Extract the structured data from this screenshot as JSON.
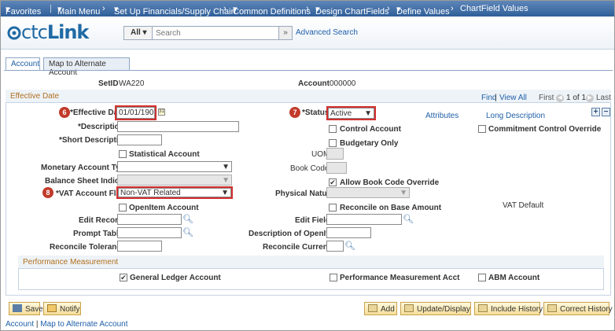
{
  "navbar": {
    "favorites": "Favorites",
    "main_menu": "Main Menu",
    "crumbs": [
      "Set Up Financials/Supply Chain",
      "Common Definitions",
      "Design ChartFields",
      "Define Values"
    ],
    "current": "ChartField Values"
  },
  "header": {
    "logo_prefix": "ctc",
    "logo_suffix": "Link",
    "search_scope": "All",
    "search_placeholder": "Search",
    "advanced_search": "Advanced Search"
  },
  "tabs": [
    {
      "label": "Account"
    },
    {
      "label": "Map to Alternate Account"
    }
  ],
  "keys": {
    "setid_label": "SetID",
    "setid_value": "WA220",
    "account_label": "Account",
    "account_value": "000000"
  },
  "effective_date_section": {
    "title": "Effective Date",
    "find": "Find",
    "view_all": "View All",
    "first": "First",
    "pager": "1 of 1",
    "last": "Last",
    "attributes": "Attributes",
    "long_description": "Long Description"
  },
  "fields": {
    "effective_date_label": "*Effective Date",
    "effective_date_value": "01/01/1901",
    "status_label": "*Status",
    "status_value": "Active",
    "description_label": "*Description",
    "short_description_label": "*Short Description",
    "control_account": "Control Account",
    "commitment_control_override": "Commitment Control Override",
    "budgetary_only": "Budgetary Only",
    "statistical_account": "Statistical Account",
    "uom_label": "UOM",
    "monetary_account_type_label": "Monetary Account Type",
    "book_code_label": "Book Code",
    "balance_sheet_indicator_label": "Balance Sheet Indicator",
    "allow_book_code_override": "Allow Book Code Override",
    "vat_account_flag_label": "*VAT Account Flag",
    "vat_account_flag_value": "Non-VAT Related",
    "physical_nature_label": "Physical Nature",
    "openitem_account": "OpenItem Account",
    "reconcile_on_base_amount": "Reconcile on Base Amount",
    "vat_default": "VAT Default",
    "edit_record_label": "Edit Record",
    "edit_field_label": "Edit Field",
    "prompt_table_label": "Prompt Table",
    "description_of_openitem_label": "Description of OpenItem",
    "reconcile_tolerance_label": "Reconcile Tolerance",
    "reconcile_currency_label": "Reconcile Currency"
  },
  "callouts": {
    "effective_date": "6",
    "status": "7",
    "vat_flag": "8"
  },
  "performance": {
    "title": "Performance Measurement",
    "general_ledger_account": "General Ledger Account",
    "performance_measurement_acct": "Performance Measurement Acct",
    "abm_account": "ABM Account"
  },
  "buttons": {
    "save": "Save",
    "notify": "Notify",
    "add": "Add",
    "update_display": "Update/Display",
    "include_history": "Include History",
    "correct_history": "Correct History"
  },
  "bottom_links": {
    "account": "Account",
    "map": "Map to Alternate Account",
    "sep": " | "
  },
  "icons": {
    "lookup": "magnifier-icon",
    "calendar": "calendar-icon",
    "add_row": "plus-icon",
    "delete_row": "minus-icon"
  }
}
